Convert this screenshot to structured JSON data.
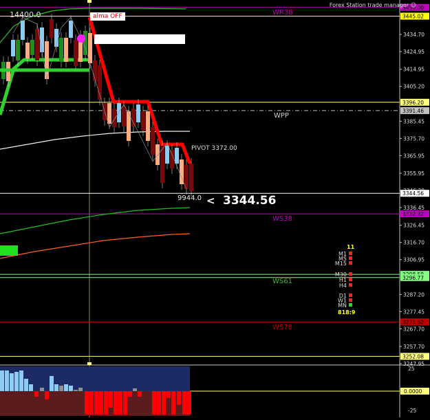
{
  "header": {
    "title": "Forex Station trade manager",
    "title_icon": "smiley-icon",
    "counter": "14400.0",
    "alma_label": "alma OFF"
  },
  "levels": {
    "wr38": {
      "label": "WR38",
      "price": 3450.0,
      "color": "#c000c0",
      "box_color": "#c000c0"
    },
    "ma_box": {
      "price": 3445.02,
      "color": "#ffff00"
    },
    "r_level": {
      "price": 3396.2,
      "color": "#ffff80"
    },
    "wpp": {
      "label": "WPP",
      "price": 3391.46,
      "color": "#c0c0c0"
    },
    "last": {
      "price": 3344.56,
      "color": "#ffffff"
    },
    "ws38": {
      "label": "WS38",
      "price": 3332.92,
      "color": "#c000c0"
    },
    "ws61_a": {
      "price": 3298.59,
      "color": "#80ff80"
    },
    "ws61": {
      "label": "WS61",
      "price": 3296.77,
      "color": "#80ff80"
    },
    "ws78": {
      "label": "WS78",
      "price": 3271.62,
      "color": "#c00000"
    },
    "low": {
      "price": 3252.08,
      "color": "#ffff80"
    }
  },
  "labels": {
    "pivot": "PIVOT 3372.00",
    "volume_value": "9944.0",
    "price_arrow": "<",
    "price_big": "3344.56"
  },
  "price_axis": {
    "ticks": [
      "3434.70",
      "3424.95",
      "3414.95",
      "3405.20",
      "3385.45",
      "3375.70",
      "3365.95",
      "3355.95",
      "3346.20",
      "3336.45",
      "3326.45",
      "3316.70",
      "3306.95",
      "3287.20",
      "3277.45",
      "3267.70",
      "3257.70",
      "3247.95"
    ],
    "box_values": [
      "3450.00",
      "3445.02",
      "3396.20",
      "3391.46",
      "3344.56",
      "3332.92",
      "3298.59",
      "3296.77",
      "3271.62",
      "3252.08"
    ]
  },
  "mtf_panel": {
    "count": "11",
    "rows": [
      {
        "tf": "M1",
        "color": "#ff2020"
      },
      {
        "tf": "M5",
        "color": "#ff2020"
      },
      {
        "tf": "M15",
        "color": "#ff2020"
      },
      {
        "tf": "M30",
        "color": "#ff2020"
      },
      {
        "tf": "H1",
        "color": "#ff2020"
      },
      {
        "tf": "H4",
        "color": "#ff2020"
      },
      {
        "tf": "D1",
        "color": "#ff2020"
      },
      {
        "tf": "W1",
        "color": "#ff2020"
      },
      {
        "tf": "MN",
        "color": "#20e020"
      }
    ],
    "footer": "818:9"
  },
  "osc_axis": {
    "top": "25",
    "mid": "0.0000",
    "bottom": "-25"
  },
  "colors": {
    "bull_candle": "#8ecbf0",
    "bear_candle": "#ffad80",
    "dark_bear": "#7a0a0a",
    "dark_bull": "#1e8c1e",
    "trend_up": "#30d030",
    "trend_down": "#ff0000",
    "osc_pos_bg": "#1c2a66",
    "osc_neg_bg": "#5a1c1c",
    "osc_pos_bar": "#8ecbf0",
    "osc_neg_bar": "#ff0000",
    "osc_grey_bar": "#909090"
  }
}
